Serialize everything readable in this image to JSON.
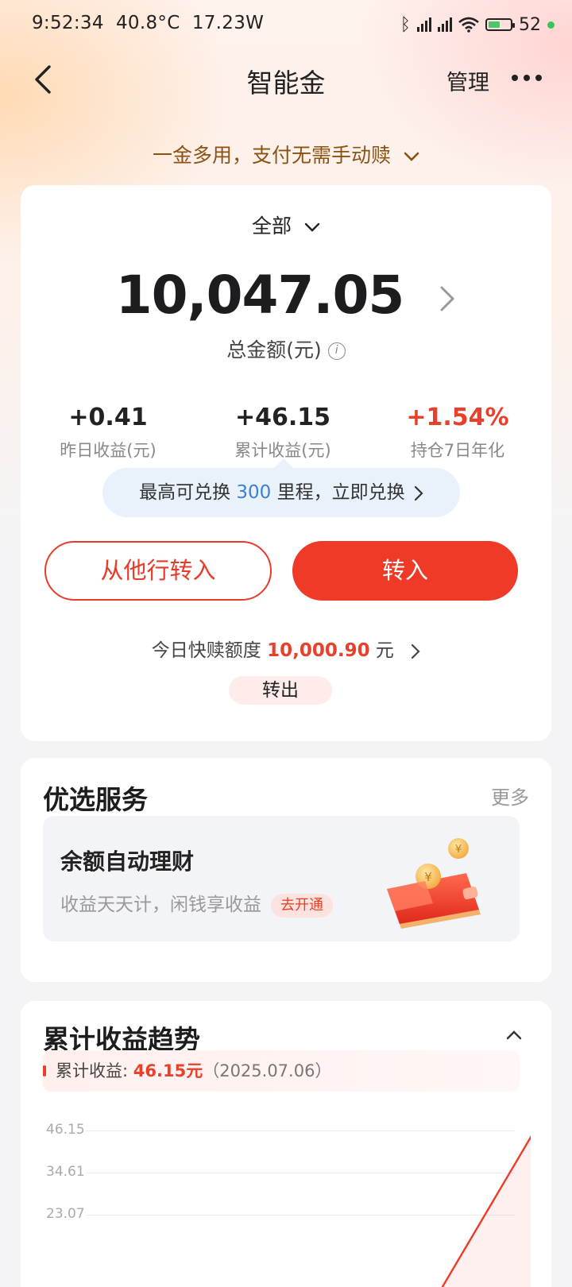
{
  "status_bar": {
    "time": "9:52:34",
    "temp": "40.8°C",
    "power": "17.23W",
    "battery": "52"
  },
  "nav": {
    "title": "智能金",
    "manage": "管理"
  },
  "tagline": "一金多用，支付无需手动赎",
  "summary_card": {
    "filter": "全部",
    "total_amount": "10,047.05",
    "total_label": "总金额(元)",
    "stats": [
      {
        "value": "+0.41",
        "label": "昨日收益(元)"
      },
      {
        "value": "+46.15",
        "label": "累计收益(元)"
      },
      {
        "value": "+1.54%",
        "label": "持仓7日年化"
      }
    ],
    "mileage": {
      "prefix": "最高可兑换 ",
      "amount": "300",
      "suffix": " 里程，立即兑换"
    },
    "transfer_from_bank": "从他行转入",
    "transfer_in": "转入",
    "quota": {
      "label": "今日快赎额度 ",
      "amount": "10,000.90",
      "unit": " 元"
    },
    "transfer_out": "转出"
  },
  "services": {
    "title": "优选服务",
    "more": "更多",
    "item": {
      "title": "余额自动理财",
      "subtitle": "收益天天计，闲钱享收益",
      "badge": "去开通"
    }
  },
  "trend": {
    "title": "累计收益趋势",
    "summary_label": "累计收益: ",
    "summary_value": "46.15元",
    "summary_date": "（2025.07.06）",
    "y_ticks": [
      "46.15",
      "34.61",
      "23.07"
    ]
  },
  "chart_data": {
    "type": "line",
    "y_ticks": [
      46.15,
      34.61,
      23.07
    ],
    "series": [
      {
        "values": [
          0,
          46.15
        ]
      }
    ]
  },
  "colors": {
    "accent": "#ee3a26",
    "blue": "#3d7fd6",
    "gold": "#8a5314"
  }
}
